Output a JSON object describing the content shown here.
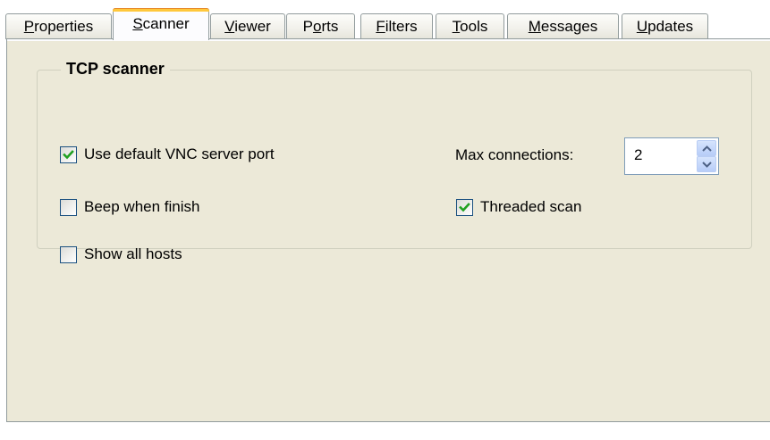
{
  "tabs": [
    {
      "label": "Properties",
      "mnemonic": "P",
      "rest": "roperties",
      "active": false
    },
    {
      "label": "Scanner",
      "mnemonic": "S",
      "rest": "canner",
      "active": true
    },
    {
      "label": "Viewer",
      "mnemonic": "V",
      "rest": "iewer",
      "active": false
    },
    {
      "label": "Ports",
      "pre": "P",
      "mnemonic": "o",
      "rest": "rts",
      "active": false
    },
    {
      "label": "Filters",
      "mnemonic": "F",
      "rest": "ilters",
      "active": false
    },
    {
      "label": "Tools",
      "mnemonic": "T",
      "rest": "ools",
      "active": false
    },
    {
      "label": "Messages",
      "mnemonic": "M",
      "rest": "essages",
      "active": false
    },
    {
      "label": "Updates",
      "mnemonic": "U",
      "rest": "pdates",
      "active": false
    }
  ],
  "group": {
    "title": "TCP scanner"
  },
  "options": {
    "use_default_port": {
      "label": "Use default VNC server port",
      "checked": true
    },
    "beep_when_finish": {
      "label": "Beep when finish",
      "checked": false
    },
    "show_all_hosts": {
      "label": "Show all hosts",
      "checked": false
    },
    "threaded_scan": {
      "label": "Threaded scan",
      "checked": true
    }
  },
  "max_connections": {
    "label": "Max connections:",
    "value": "2"
  },
  "colors": {
    "panel_bg": "#ece9d8",
    "tab_border": "#919b9c",
    "active_tab_highlight": "#ffc83c",
    "checkmark": "#21a121",
    "checkbox_border": "#1c5180"
  },
  "icons": {
    "check": "checkmark-icon",
    "spin_up": "spin-up-arrow-icon",
    "spin_down": "spin-down-arrow-icon"
  }
}
